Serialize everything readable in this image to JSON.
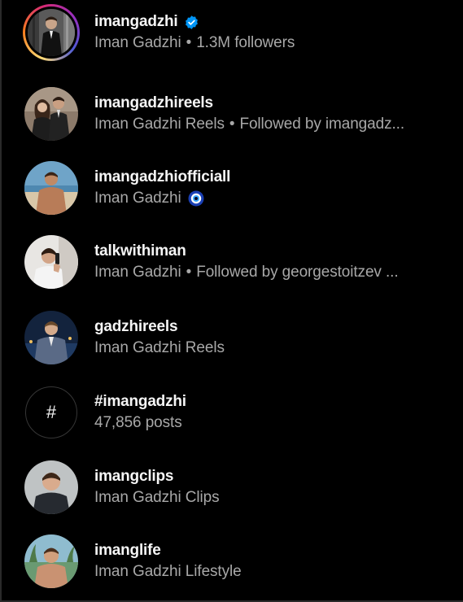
{
  "results": [
    {
      "username": "imangadzhi",
      "verified": true,
      "full_name": "Iman Gadzhi",
      "extra": "1.3M followers",
      "avatar": "man-in-suit-photo",
      "has_story_ring": true
    },
    {
      "username": "imangadzhireels",
      "verified": false,
      "full_name": "Iman Gadzhi Reels",
      "extra": "Followed by imangadz...",
      "avatar": "couple-photo",
      "has_story_ring": false
    },
    {
      "username": "imangadzhiofficiall",
      "verified": false,
      "full_name": "Iman Gadzhi",
      "extra": "",
      "avatar": "man-beach-photo",
      "has_story_ring": false,
      "badge": "nazar-evil-eye-emoji"
    },
    {
      "username": "talkwithiman",
      "verified": false,
      "full_name": "Iman Gadzhi",
      "extra": "Followed by georgestoitzev ...",
      "avatar": "man-on-phone-photo",
      "has_story_ring": false
    },
    {
      "username": "gadzhireels",
      "verified": false,
      "full_name": "Iman Gadzhi Reels",
      "extra": "",
      "avatar": "man-city-night-photo",
      "has_story_ring": false
    },
    {
      "username": "#imangadzhi",
      "verified": false,
      "full_name": "47,856 posts",
      "extra": "",
      "avatar": "hashtag-icon",
      "hash_symbol": "#",
      "has_story_ring": false
    },
    {
      "username": "imangclips",
      "verified": false,
      "full_name": "Iman Gadzhi Clips",
      "extra": "",
      "avatar": "man-portrait-photo",
      "has_story_ring": false
    },
    {
      "username": "imanglife",
      "verified": false,
      "full_name": "Iman Gadzhi Lifestyle",
      "extra": "",
      "avatar": "man-tropical-photo",
      "has_story_ring": false
    }
  ],
  "separator": "•",
  "colors": {
    "background": "#000000",
    "username": "#f5f5f5",
    "subtitle": "#a8a8a8",
    "verified_blue": "#0095f6"
  }
}
